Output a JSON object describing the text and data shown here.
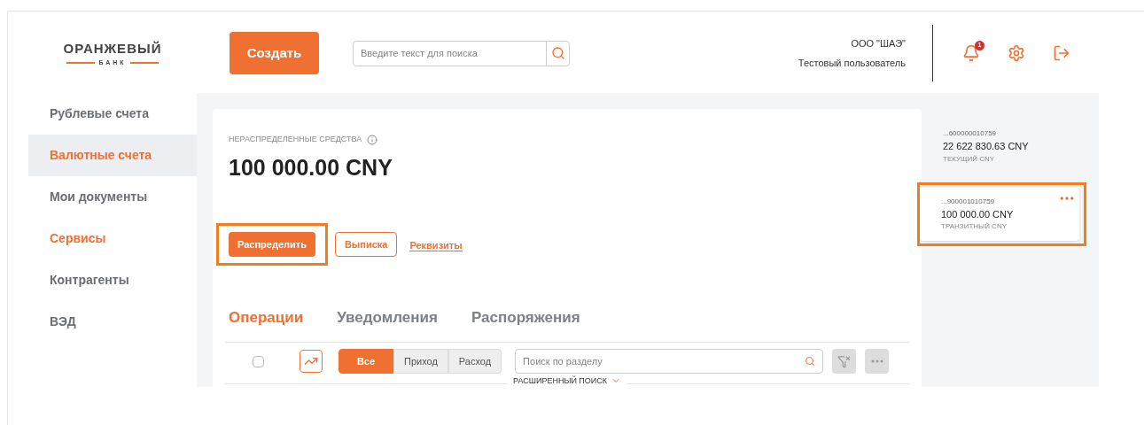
{
  "logo": {
    "title": "ОРАНЖЕВЫЙ",
    "subtitle": "БАНК"
  },
  "create_button": "Создать",
  "search": {
    "placeholder": "Введите текст для поиска"
  },
  "user": {
    "company": "ООО \"ШАЭ\"",
    "name": "Тестовый пользователь"
  },
  "notifications": {
    "count": "1"
  },
  "sidebar": {
    "items": [
      {
        "label": "Рублевые счета",
        "selected": false,
        "accent": false
      },
      {
        "label": "Валютные счета",
        "selected": true,
        "accent": true
      },
      {
        "label": "Мои документы",
        "selected": false,
        "accent": false
      },
      {
        "label": "Сервисы",
        "selected": false,
        "accent": true
      },
      {
        "label": "Контрагенты",
        "selected": false,
        "accent": false
      },
      {
        "label": "ВЭД",
        "selected": false,
        "accent": false
      }
    ]
  },
  "balance": {
    "label": "НЕРАСПРЕДЕЛЕННЫЕ СРЕДСТВА",
    "amount": "100 000.00 CNY"
  },
  "actions": [
    {
      "kind": "primary",
      "label": "Распределить",
      "highlighted": true
    },
    {
      "kind": "outline",
      "label": "Выписка",
      "highlighted": false
    },
    {
      "kind": "link",
      "label": "Реквизиты",
      "highlighted": false
    }
  ],
  "tabs": [
    {
      "label": "Операции",
      "selected": true
    },
    {
      "label": "Уведомления",
      "selected": false
    },
    {
      "label": "Распоряжения",
      "selected": false
    }
  ],
  "toolbar": {
    "select_all_checked": false,
    "filters": [
      {
        "label": "Все",
        "selected": true
      },
      {
        "label": "Приход",
        "selected": false
      },
      {
        "label": "Расход",
        "selected": false
      }
    ],
    "search_placeholder": "Поиск по разделу",
    "advanced_search": "РАСШИРЕННЫЙ ПОИСК"
  },
  "accounts": [
    {
      "number": "...600000010759",
      "amount": "22 622 830.63 CNY",
      "type": "ТЕКУЩИЙ CNY",
      "selected": false,
      "highlighted": false
    },
    {
      "number": "...900001010759",
      "amount": "100 000.00 CNY",
      "type": "ТРАНЗИТНЫЙ CNY",
      "selected": true,
      "highlighted": true
    }
  ]
}
